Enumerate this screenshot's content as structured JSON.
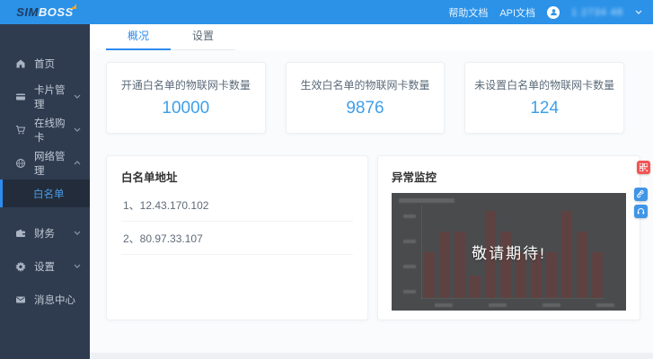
{
  "brand": {
    "sim": "SIM",
    "boss": "BOSS"
  },
  "topbar": {
    "links": [
      "帮助文档",
      "API文档"
    ],
    "username": "1 2734 48",
    "username_masked": true
  },
  "tabs": [
    {
      "label": "概况",
      "active": true
    },
    {
      "label": "设置",
      "active": false
    }
  ],
  "sidebar": {
    "items": [
      {
        "label": "首页",
        "icon": "home-icon",
        "chevron": null
      },
      {
        "label": "卡片管理",
        "icon": "card-icon",
        "chevron": "down"
      },
      {
        "label": "在线购卡",
        "icon": "cart-icon",
        "chevron": "down"
      },
      {
        "label": "网络管理",
        "icon": "network-icon",
        "chevron": "up",
        "expanded": true
      },
      {
        "label": "财务",
        "icon": "wallet-icon",
        "chevron": "down"
      },
      {
        "label": "设置",
        "icon": "gear-icon",
        "chevron": "down"
      },
      {
        "label": "消息中心",
        "icon": "envelope-icon",
        "chevron": null
      }
    ],
    "submenu": {
      "label": "白名单",
      "parent": "网络管理",
      "active": true
    }
  },
  "stats": [
    {
      "title": "开通白名单的物联网卡数量",
      "value": "10000"
    },
    {
      "title": "生效白名单的物联网卡数量",
      "value": "9876"
    },
    {
      "title": "未设置白名单的物联网卡数量",
      "value": "124"
    }
  ],
  "whitelist": {
    "title": "白名单地址",
    "items": [
      "1、12.43.170.102",
      "2、80.97.33.107"
    ]
  },
  "monitor": {
    "title": "异常监控",
    "overlay_text": "敬请期待!",
    "chart": {
      "type": "bar",
      "values": [
        52,
        75,
        75,
        25,
        98,
        75,
        52,
        52,
        52,
        98,
        75,
        52
      ],
      "ylim": [
        0,
        100
      ],
      "bar_color": "#5e4242",
      "background": "#4a4b4d",
      "note": "dimmed behind coming-soon overlay, axis labels illegible"
    }
  },
  "colors": {
    "header_blue": "#2b92e8",
    "accent_blue": "#2d8cf0",
    "value_blue": "#3f9fe8",
    "sidebar_dark": "#2f3c50",
    "sidebar_active_bg": "#232c3a",
    "danger_red": "#f25555",
    "logo_accent_orange": "#f5a623",
    "chart_bg": "#4a4b4d",
    "chart_bar": "#5e4242"
  }
}
